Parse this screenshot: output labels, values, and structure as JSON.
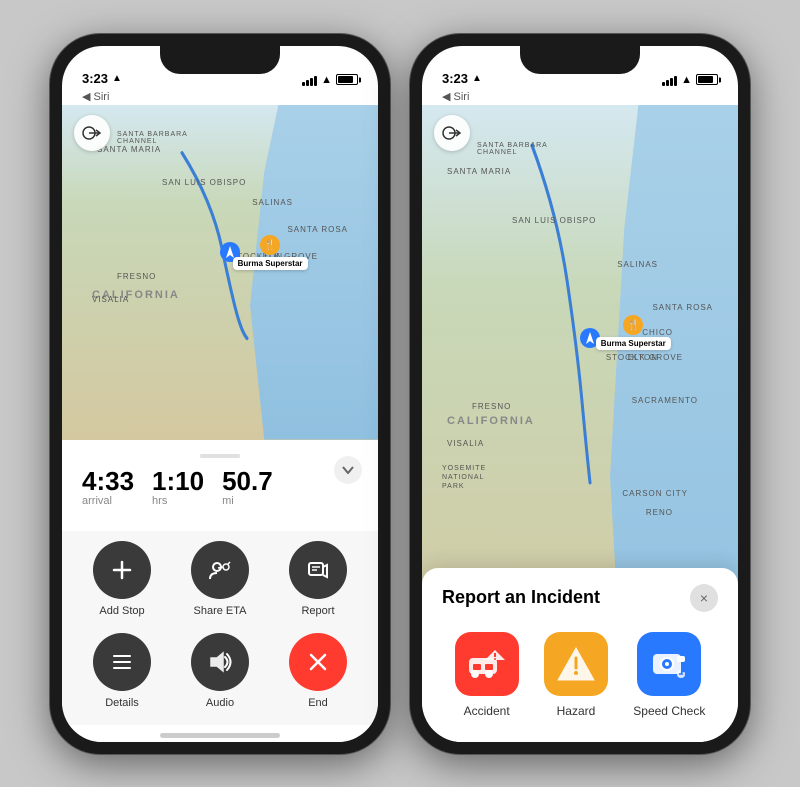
{
  "phone1": {
    "status": {
      "time": "3:23",
      "signal": true,
      "wifi": true,
      "battery": true,
      "siri": "◀ Siri"
    },
    "map": {
      "destination": "Burma Superstar",
      "back_title": ""
    },
    "nav": {
      "arrival": "4:33",
      "arrival_label": "arrival",
      "hrs": "1:10",
      "hrs_label": "hrs",
      "distance": "50.7",
      "distance_unit": "mi"
    },
    "actions": [
      {
        "id": "add-stop",
        "label": "Add Stop",
        "icon": "+",
        "style": "dark"
      },
      {
        "id": "share-eta",
        "label": "Share ETA",
        "icon": "👤+",
        "style": "dark"
      },
      {
        "id": "report",
        "label": "Report",
        "icon": "💬",
        "style": "dark"
      },
      {
        "id": "details",
        "label": "Details",
        "icon": "≡",
        "style": "dark"
      },
      {
        "id": "audio",
        "label": "Audio",
        "icon": "🔊",
        "style": "dark"
      },
      {
        "id": "end",
        "label": "End",
        "icon": "✕",
        "style": "red"
      }
    ]
  },
  "phone2": {
    "status": {
      "time": "3:23",
      "siri": "◀ Siri"
    },
    "map": {
      "destination": "Burma Superstar"
    },
    "report_modal": {
      "title": "Report an Incident",
      "close_label": "×",
      "options": [
        {
          "id": "accident",
          "label": "Accident",
          "icon": "🚗",
          "style": "accident"
        },
        {
          "id": "hazard",
          "label": "Hazard",
          "icon": "⚠️",
          "style": "hazard"
        },
        {
          "id": "speed-check",
          "label": "Speed Check",
          "icon": "📷",
          "style": "speed"
        }
      ]
    }
  },
  "map_labels": {
    "california": "CALIFORNIA",
    "santa_maria": "Santa Maria",
    "sb_channel": "Santa Barbara\nChannel",
    "san_luis": "San Luis Obispo",
    "salinas": "Salinas",
    "fresno": "Fresno",
    "visalia": "Visalia",
    "stockton": "Stockton",
    "santa_rosa": "Santa Rosa",
    "elk_grove": "Elk Grove",
    "sacramento": "Sacramento",
    "yosemite": "YOSEMITE\nNATIONAL\nPARK",
    "reno": "Reno",
    "carson_city": "Carson City",
    "chico": "Chico"
  }
}
